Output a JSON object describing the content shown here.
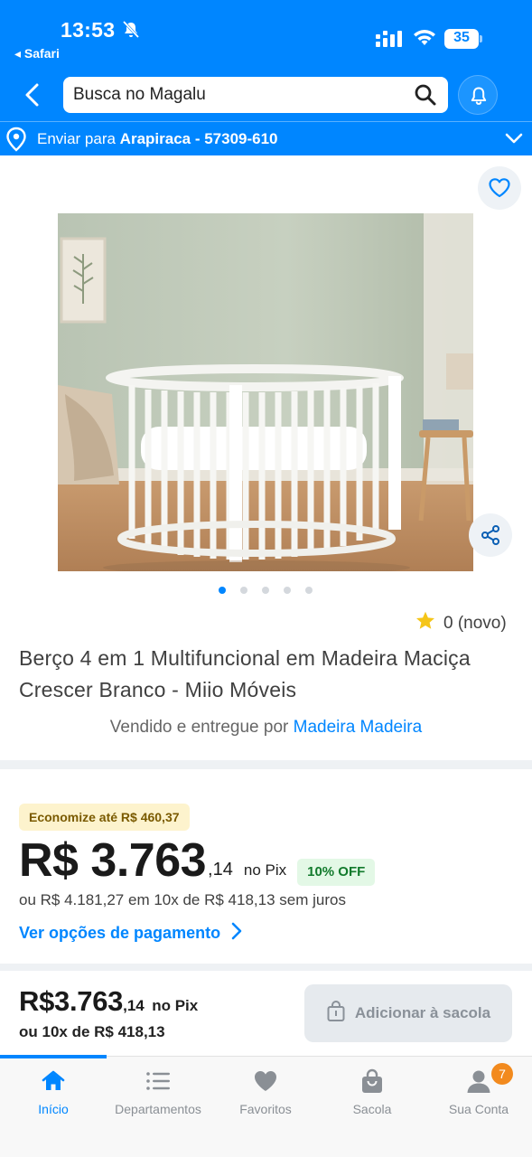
{
  "status_bar": {
    "time": "13:53",
    "back_app": "◂ Safari",
    "battery": "35"
  },
  "header": {
    "search_placeholder": "Busca no Magalu",
    "delivery_prefix": "Enviar para",
    "delivery_location": "Arapiraca - 57309-610"
  },
  "product": {
    "rating": "0 (novo)",
    "title": "Berço 4 em 1 Multifuncional em Madeira Maciça Crescer Branco - Miio Móveis",
    "seller_prefix": "Vendido e entregue por",
    "seller_name": "Madeira Madeira",
    "image_count": 5,
    "active_image": 0
  },
  "pricing": {
    "economy_badge": "Economize até R$ 460,37",
    "price_main": "R$ 3.763",
    "price_cents": ",14",
    "pix_label": "no Pix",
    "off_badge": "10% OFF",
    "installments": "ou R$ 4.181,27 em 10x de R$ 418,13 sem juros",
    "payment_options_link": "Ver opções de pagamento"
  },
  "sticky": {
    "price_main": "R$3.763",
    "price_cents": ",14",
    "pix_label": "no Pix",
    "installments": "ou 10x de R$ 418,13",
    "add_button": "Adicionar à sacola"
  },
  "tabbar": {
    "items": [
      {
        "label": "Início",
        "icon": "home-icon"
      },
      {
        "label": "Departamentos",
        "icon": "menu-icon"
      },
      {
        "label": "Favoritos",
        "icon": "heart-icon"
      },
      {
        "label": "Sacola",
        "icon": "bag-icon"
      },
      {
        "label": "Sua Conta",
        "icon": "user-icon"
      }
    ],
    "account_badge": "7"
  },
  "colors": {
    "brand_blue": "#0086ff",
    "badge_orange": "#f28a1e",
    "off_green": "#127a2c"
  }
}
